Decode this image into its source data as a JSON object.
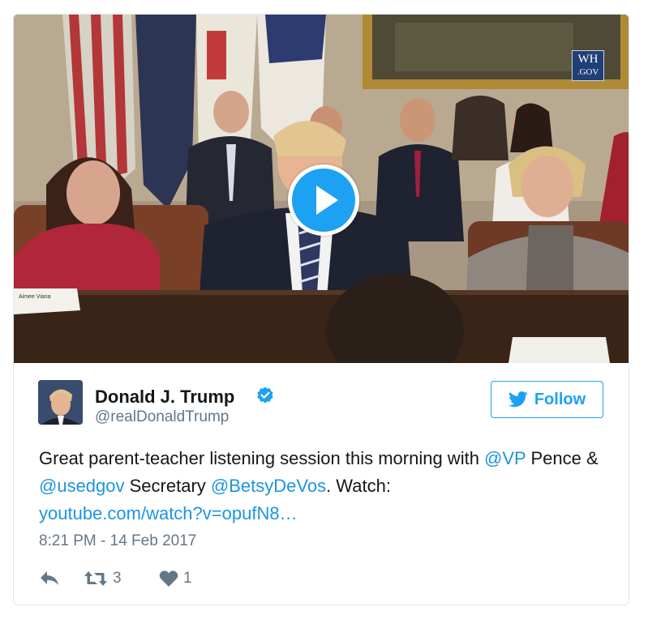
{
  "video": {
    "watermark": {
      "line1": "WH",
      "line2": ".GOV"
    },
    "nameplate": "Aimee Viana"
  },
  "author": {
    "name": "Donald J. Trump",
    "handle": "@realDonaldTrump"
  },
  "follow_label": "Follow",
  "tweet": {
    "part1": "Great parent-teacher listening session this morning with ",
    "mention_vp": "@VP",
    "part2": " Pence & ",
    "mention_usedgov": "@usedgov",
    "part3": " Secretary ",
    "mention_devos": "@BetsyDeVos",
    "part4": ". Watch: ",
    "link": "youtube.com/watch?v=opufN8…"
  },
  "timestamp": "8:21 PM - 14 Feb 2017",
  "actions": {
    "retweets": "3",
    "likes": "1"
  },
  "colors": {
    "accent": "#1da1f2",
    "link": "#1b95e0",
    "muted": "#657786"
  }
}
